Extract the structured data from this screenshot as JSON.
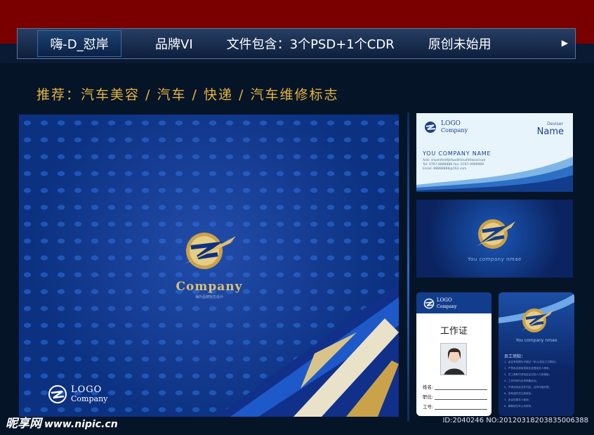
{
  "header": {
    "brand": "嗨-D_怼岸",
    "items": [
      "品牌VI",
      "文件包含：3个PSD+1个CDR",
      "原创未始用"
    ],
    "arrow_icon": "play-arrow-icon"
  },
  "recommend": "推荐：汽车美容 / 汽车 / 快递 / 汽车维修标志",
  "main_panel": {
    "company": "Company",
    "tagline": "海外品牌标志设计",
    "footer_logo_line1": "LOGO",
    "footer_logo_line2": "Company"
  },
  "business_card_front": {
    "logo_line1": "LOGO",
    "logo_line2": "Company",
    "deviser": "Deviser",
    "name": "Name",
    "company": "YOU COMPANY  NAME",
    "lines": [
      "Add: shashifeidfjkfaadlifshafdfdsserisad",
      "Tel: 0797-8888888   Fax: 0797-9999999",
      "Email: 88888888@163.com"
    ]
  },
  "business_card_back": {
    "company": "You company nmae"
  },
  "id_card_front": {
    "logo_line1": "LOGO",
    "logo_line2": "Company",
    "title": "工作证",
    "fields": [
      "姓名:",
      "职位:",
      "工号:"
    ]
  },
  "id_card_back": {
    "company": "You company nmae",
    "notes_title": "员工须知：",
    "notes": [
      "1、此证有效期为不超过一年(从发证之日算起)；",
      "2、严禁私自使用或将此证借给他人使用；",
      "3、员工离职时须将此证交回人力资源部；",
      "4、工作时间内必须佩戴此证；",
      "5、不得涂改此证件内容，否则作废处理；",
      "6、若有遗失须立即报告；",
      "7、此证仅限本人使用；",
      "8、解释权归本公司所有。"
    ]
  },
  "watermark": {
    "brand": "昵享网",
    "site": "www.nipic.cn",
    "id_text": "ID:2040246 NO:20120318203835006388"
  },
  "colors": {
    "top_red": "#7a0000",
    "gold": "#e5b43c",
    "navy": "#0c3181"
  }
}
